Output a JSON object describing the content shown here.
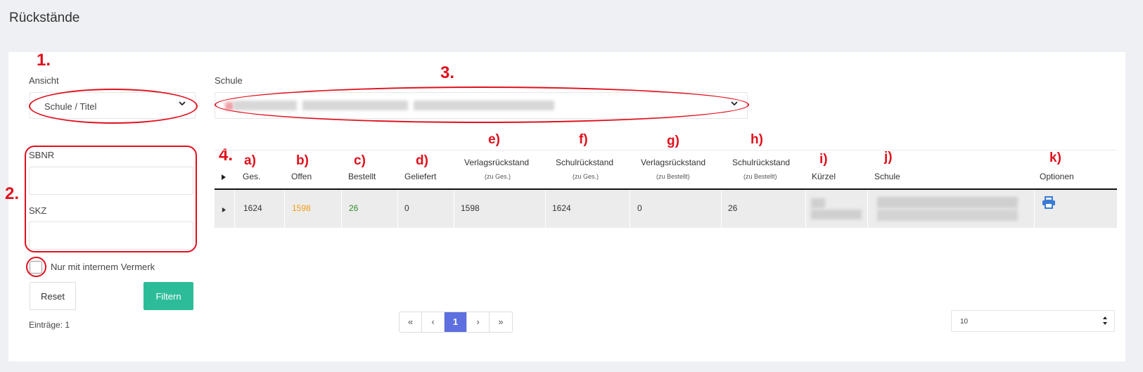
{
  "page": {
    "title": "Rückstände"
  },
  "annotations": {
    "n1": "1.",
    "n2": "2.",
    "n3": "3.",
    "n4": "4.",
    "a": "a)",
    "b": "b)",
    "c": "c)",
    "d": "d)",
    "e": "e)",
    "f": "f)",
    "g": "g)",
    "h": "h)",
    "i": "i)",
    "j": "j)",
    "k": "k)"
  },
  "filters": {
    "ansicht_label": "Ansicht",
    "ansicht_value": "Schule / Titel",
    "schule_label": "Schule",
    "sbnr_label": "SBNR",
    "sbnr_value": "",
    "skz_label": "SKZ",
    "skz_value": "",
    "checkbox_label": "Nur mit internem Vermerk",
    "reset_label": "Reset",
    "filter_label": "Filtern",
    "entries_text": "Einträge: 1"
  },
  "table": {
    "headers": {
      "ges": "Ges.",
      "offen": "Offen",
      "bestellt": "Bestellt",
      "geliefert": "Geliefert",
      "verlag_ges": "Verlagsrückstand",
      "verlag_ges_sub": "(zu Ges.)",
      "schul_ges": "Schulrückstand",
      "schul_ges_sub": "(zu Ges.)",
      "verlag_best": "Verlagsrückstand",
      "verlag_best_sub": "(zu Bestellt)",
      "schul_best": "Schulrückstand",
      "schul_best_sub": "(zu Bestellt)",
      "kuerzel": "Kürzel",
      "schule": "Schule",
      "optionen": "Optionen"
    },
    "rows": [
      {
        "ges": "1624",
        "offen": "1598",
        "bestellt": "26",
        "geliefert": "0",
        "verlag_ges": "1598",
        "schul_ges": "1624",
        "verlag_best": "0",
        "schul_best": "26"
      }
    ]
  },
  "pagination": {
    "first": "«",
    "prev": "‹",
    "current": "1",
    "next": "›",
    "last": "»",
    "per_page": "10"
  },
  "colors": {
    "offen": "#f39c12",
    "bestellt": "#2e8b2e",
    "accent": "#2dbc9a",
    "page_active": "#5e6fe0",
    "annotation": "#e0101d",
    "print_icon": "#3a7bd5"
  },
  "icons": {
    "expand": "triangle-right",
    "chevron": "chevron-down",
    "print": "printer",
    "sort": "up-down"
  }
}
